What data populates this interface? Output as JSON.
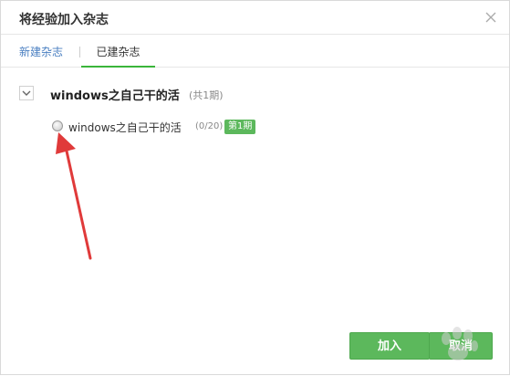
{
  "dialog": {
    "title": "将经验加入杂志",
    "tabs": [
      {
        "label": "新建杂志"
      },
      {
        "label": "已建杂志"
      }
    ]
  },
  "magazine": {
    "title": "windows之自己干的活",
    "count_text": "(共1期)",
    "issue": {
      "name": "windows之自己干的活",
      "progress": "(0/20)",
      "badge": "第1期"
    }
  },
  "buttons": {
    "add": "加入",
    "cancel": "取消"
  },
  "colors": {
    "accent_green": "#5cb85c",
    "tab_underline": "#3ab53a",
    "arrow_red": "#e03a3a",
    "link_blue": "#4a7fc1"
  }
}
